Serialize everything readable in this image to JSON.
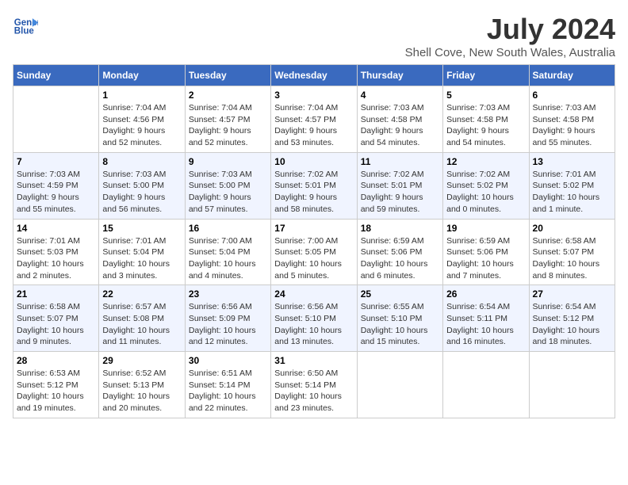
{
  "header": {
    "logo_line1": "General",
    "logo_line2": "Blue",
    "month": "July 2024",
    "location": "Shell Cove, New South Wales, Australia"
  },
  "weekdays": [
    "Sunday",
    "Monday",
    "Tuesday",
    "Wednesday",
    "Thursday",
    "Friday",
    "Saturday"
  ],
  "weeks": [
    [
      {
        "day": "",
        "info": ""
      },
      {
        "day": "1",
        "info": "Sunrise: 7:04 AM\nSunset: 4:56 PM\nDaylight: 9 hours\nand 52 minutes."
      },
      {
        "day": "2",
        "info": "Sunrise: 7:04 AM\nSunset: 4:57 PM\nDaylight: 9 hours\nand 52 minutes."
      },
      {
        "day": "3",
        "info": "Sunrise: 7:04 AM\nSunset: 4:57 PM\nDaylight: 9 hours\nand 53 minutes."
      },
      {
        "day": "4",
        "info": "Sunrise: 7:03 AM\nSunset: 4:58 PM\nDaylight: 9 hours\nand 54 minutes."
      },
      {
        "day": "5",
        "info": "Sunrise: 7:03 AM\nSunset: 4:58 PM\nDaylight: 9 hours\nand 54 minutes."
      },
      {
        "day": "6",
        "info": "Sunrise: 7:03 AM\nSunset: 4:58 PM\nDaylight: 9 hours\nand 55 minutes."
      }
    ],
    [
      {
        "day": "7",
        "info": "Sunrise: 7:03 AM\nSunset: 4:59 PM\nDaylight: 9 hours\nand 55 minutes."
      },
      {
        "day": "8",
        "info": "Sunrise: 7:03 AM\nSunset: 5:00 PM\nDaylight: 9 hours\nand 56 minutes."
      },
      {
        "day": "9",
        "info": "Sunrise: 7:03 AM\nSunset: 5:00 PM\nDaylight: 9 hours\nand 57 minutes."
      },
      {
        "day": "10",
        "info": "Sunrise: 7:02 AM\nSunset: 5:01 PM\nDaylight: 9 hours\nand 58 minutes."
      },
      {
        "day": "11",
        "info": "Sunrise: 7:02 AM\nSunset: 5:01 PM\nDaylight: 9 hours\nand 59 minutes."
      },
      {
        "day": "12",
        "info": "Sunrise: 7:02 AM\nSunset: 5:02 PM\nDaylight: 10 hours\nand 0 minutes."
      },
      {
        "day": "13",
        "info": "Sunrise: 7:01 AM\nSunset: 5:02 PM\nDaylight: 10 hours\nand 1 minute."
      }
    ],
    [
      {
        "day": "14",
        "info": "Sunrise: 7:01 AM\nSunset: 5:03 PM\nDaylight: 10 hours\nand 2 minutes."
      },
      {
        "day": "15",
        "info": "Sunrise: 7:01 AM\nSunset: 5:04 PM\nDaylight: 10 hours\nand 3 minutes."
      },
      {
        "day": "16",
        "info": "Sunrise: 7:00 AM\nSunset: 5:04 PM\nDaylight: 10 hours\nand 4 minutes."
      },
      {
        "day": "17",
        "info": "Sunrise: 7:00 AM\nSunset: 5:05 PM\nDaylight: 10 hours\nand 5 minutes."
      },
      {
        "day": "18",
        "info": "Sunrise: 6:59 AM\nSunset: 5:06 PM\nDaylight: 10 hours\nand 6 minutes."
      },
      {
        "day": "19",
        "info": "Sunrise: 6:59 AM\nSunset: 5:06 PM\nDaylight: 10 hours\nand 7 minutes."
      },
      {
        "day": "20",
        "info": "Sunrise: 6:58 AM\nSunset: 5:07 PM\nDaylight: 10 hours\nand 8 minutes."
      }
    ],
    [
      {
        "day": "21",
        "info": "Sunrise: 6:58 AM\nSunset: 5:07 PM\nDaylight: 10 hours\nand 9 minutes."
      },
      {
        "day": "22",
        "info": "Sunrise: 6:57 AM\nSunset: 5:08 PM\nDaylight: 10 hours\nand 11 minutes."
      },
      {
        "day": "23",
        "info": "Sunrise: 6:56 AM\nSunset: 5:09 PM\nDaylight: 10 hours\nand 12 minutes."
      },
      {
        "day": "24",
        "info": "Sunrise: 6:56 AM\nSunset: 5:10 PM\nDaylight: 10 hours\nand 13 minutes."
      },
      {
        "day": "25",
        "info": "Sunrise: 6:55 AM\nSunset: 5:10 PM\nDaylight: 10 hours\nand 15 minutes."
      },
      {
        "day": "26",
        "info": "Sunrise: 6:54 AM\nSunset: 5:11 PM\nDaylight: 10 hours\nand 16 minutes."
      },
      {
        "day": "27",
        "info": "Sunrise: 6:54 AM\nSunset: 5:12 PM\nDaylight: 10 hours\nand 18 minutes."
      }
    ],
    [
      {
        "day": "28",
        "info": "Sunrise: 6:53 AM\nSunset: 5:12 PM\nDaylight: 10 hours\nand 19 minutes."
      },
      {
        "day": "29",
        "info": "Sunrise: 6:52 AM\nSunset: 5:13 PM\nDaylight: 10 hours\nand 20 minutes."
      },
      {
        "day": "30",
        "info": "Sunrise: 6:51 AM\nSunset: 5:14 PM\nDaylight: 10 hours\nand 22 minutes."
      },
      {
        "day": "31",
        "info": "Sunrise: 6:50 AM\nSunset: 5:14 PM\nDaylight: 10 hours\nand 23 minutes."
      },
      {
        "day": "",
        "info": ""
      },
      {
        "day": "",
        "info": ""
      },
      {
        "day": "",
        "info": ""
      }
    ]
  ]
}
